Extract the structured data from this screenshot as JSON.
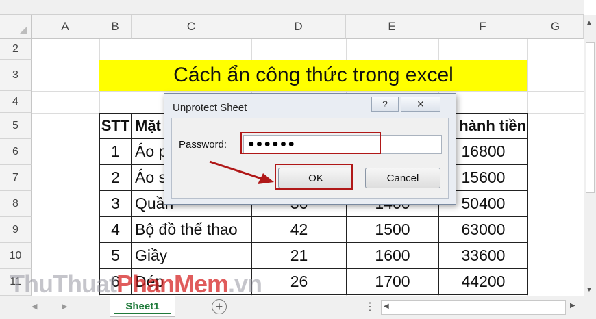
{
  "sheet": {
    "columns": [
      "A",
      "B",
      "C",
      "D",
      "E",
      "F",
      "G"
    ],
    "rows": [
      "2",
      "3",
      "4",
      "5",
      "6",
      "7",
      "8",
      "9",
      "10",
      "11"
    ],
    "title": "Cách ẩn công thức trong excel",
    "title_bg": "#ffff00",
    "table_header": {
      "stt": "STT",
      "item_partial": "Mặt",
      "total_partial": "hành tiền"
    },
    "table_rows": [
      {
        "stt": "1",
        "name": "Áo p",
        "qty": "",
        "price": "",
        "total": "16800"
      },
      {
        "stt": "2",
        "name": "Áo s",
        "qty": "",
        "price": "",
        "total": "15600"
      },
      {
        "stt": "3",
        "name": "Quần",
        "qty": "36",
        "price": "1400",
        "total": "50400"
      },
      {
        "stt": "4",
        "name": "Bộ đồ thể thao",
        "qty": "42",
        "price": "1500",
        "total": "63000"
      },
      {
        "stt": "5",
        "name": "Giầy",
        "qty": "21",
        "price": "1600",
        "total": "33600"
      },
      {
        "stt": "6",
        "name": "Dép",
        "qty": "26",
        "price": "1700",
        "total": "44200"
      }
    ]
  },
  "dialog": {
    "title": "Unprotect Sheet",
    "help_label": "?",
    "close_label": "✕",
    "password_label": "Password:",
    "password_mnemonic": "P",
    "password_rest": "assword:",
    "password_value": "●●●●●●",
    "ok_label": "OK",
    "cancel_label": "Cancel",
    "highlight_color": "#b01818"
  },
  "tabs": {
    "sheet_name": "Sheet1",
    "add_sheet_label": "+",
    "nav_prev": "◀",
    "nav_next": "▶",
    "more": "⋮",
    "scroll_left": "◀",
    "scroll_right": "▶"
  },
  "scrollbar": {
    "up": "▲",
    "down": "▼"
  },
  "watermark": {
    "part1": "ThuThuat",
    "part2": "PhanMem",
    "part3": ".vn"
  }
}
